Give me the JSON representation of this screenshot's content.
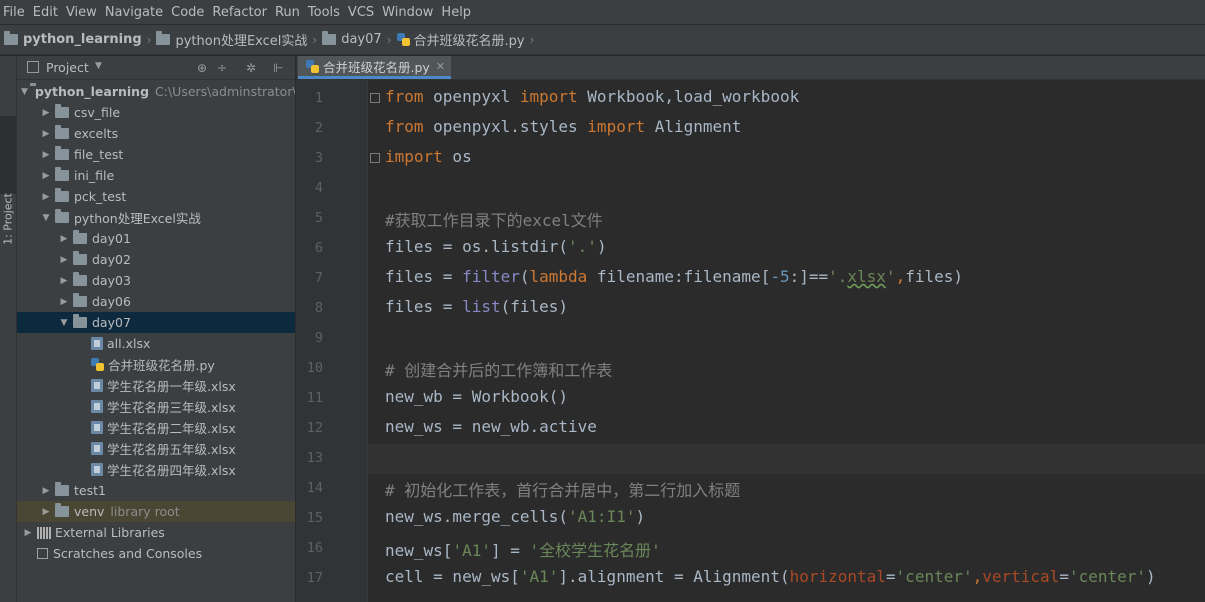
{
  "menu": [
    "File",
    "Edit",
    "View",
    "Navigate",
    "Code",
    "Refactor",
    "Run",
    "Tools",
    "VCS",
    "Window",
    "Help"
  ],
  "breadcrumbs": [
    {
      "label": "python_learning",
      "icon": "folder",
      "bold": true
    },
    {
      "label": "python处理Excel实战",
      "icon": "folder",
      "bold": false
    },
    {
      "label": "day07",
      "icon": "folder",
      "bold": false
    },
    {
      "label": "合并班级花名册.py",
      "icon": "python-file",
      "bold": false
    }
  ],
  "sidebar_strip_label": "1: Project",
  "project_panel": {
    "title": "Project",
    "tree": [
      {
        "label": "python_learning",
        "extra": "C:\\Users\\adminstrator\\",
        "depth": 0,
        "arrow": "down",
        "icon": "folder",
        "bold": true
      },
      {
        "label": "csv_file",
        "depth": 1,
        "arrow": "right",
        "icon": "folder"
      },
      {
        "label": "excelts",
        "depth": 1,
        "arrow": "right",
        "icon": "folder"
      },
      {
        "label": "file_test",
        "depth": 1,
        "arrow": "right",
        "icon": "folder"
      },
      {
        "label": "ini_file",
        "depth": 1,
        "arrow": "right",
        "icon": "folder"
      },
      {
        "label": "pck_test",
        "depth": 1,
        "arrow": "right",
        "icon": "folder"
      },
      {
        "label": "python处理Excel实战",
        "depth": 1,
        "arrow": "down",
        "icon": "folder"
      },
      {
        "label": "day01",
        "depth": 2,
        "arrow": "right",
        "icon": "folder"
      },
      {
        "label": "day02",
        "depth": 2,
        "arrow": "right",
        "icon": "folder"
      },
      {
        "label": "day03",
        "depth": 2,
        "arrow": "right",
        "icon": "folder"
      },
      {
        "label": "day06",
        "depth": 2,
        "arrow": "right",
        "icon": "folder"
      },
      {
        "label": "day07",
        "depth": 2,
        "arrow": "down",
        "icon": "folder",
        "selected": true
      },
      {
        "label": "all.xlsx",
        "depth": 3,
        "arrow": "",
        "icon": "xlsx"
      },
      {
        "label": "合并班级花名册.py",
        "depth": 3,
        "arrow": "",
        "icon": "python"
      },
      {
        "label": "学生花名册一年级.xlsx",
        "depth": 3,
        "arrow": "",
        "icon": "xlsx"
      },
      {
        "label": "学生花名册三年级.xlsx",
        "depth": 3,
        "arrow": "",
        "icon": "xlsx"
      },
      {
        "label": "学生花名册二年级.xlsx",
        "depth": 3,
        "arrow": "",
        "icon": "xlsx"
      },
      {
        "label": "学生花名册五年级.xlsx",
        "depth": 3,
        "arrow": "",
        "icon": "xlsx"
      },
      {
        "label": "学生花名册四年级.xlsx",
        "depth": 3,
        "arrow": "",
        "icon": "xlsx"
      },
      {
        "label": "test1",
        "depth": 1,
        "arrow": "right",
        "icon": "folder"
      },
      {
        "label": "venv",
        "extra": "library root",
        "depth": 1,
        "arrow": "right",
        "icon": "folder",
        "venv": true
      },
      {
        "label": "External Libraries",
        "depth": 0,
        "arrow": "right",
        "icon": "library"
      },
      {
        "label": "Scratches and Consoles",
        "depth": 0,
        "arrow": "",
        "icon": "scratch"
      }
    ]
  },
  "editor": {
    "tab_label": "合并班级花名册.py",
    "current_line": 13,
    "lines": [
      [
        [
          "kw",
          "from"
        ],
        [
          "p",
          " openpyxl "
        ],
        [
          "kw",
          "import"
        ],
        [
          "p",
          " Workbook,load_workbook"
        ]
      ],
      [
        [
          "kw",
          "from"
        ],
        [
          "p",
          " openpyxl.styles "
        ],
        [
          "kw",
          "import"
        ],
        [
          "p",
          " Alignment"
        ]
      ],
      [
        [
          "kw",
          "import"
        ],
        [
          "p",
          " os"
        ]
      ],
      [],
      [
        [
          "cmt",
          "#获取工作目录下的excel文件"
        ]
      ],
      [
        [
          "p",
          "files = os.listdir("
        ],
        [
          "str",
          "'.'"
        ],
        [
          "p",
          ")"
        ]
      ],
      [
        [
          "p",
          "files = "
        ],
        [
          "bi",
          "filter"
        ],
        [
          "p",
          "("
        ],
        [
          "kw",
          "lambda"
        ],
        [
          "p",
          " filename:filename["
        ],
        [
          "num",
          "-5"
        ],
        [
          "p",
          ":]=="
        ],
        [
          "str",
          "'."
        ],
        [
          "sq",
          "xlsx"
        ],
        [
          "str",
          "'"
        ],
        [
          "kw",
          ","
        ],
        [
          "p",
          "files)"
        ]
      ],
      [
        [
          "p",
          "files = "
        ],
        [
          "bi",
          "list"
        ],
        [
          "p",
          "(files)"
        ]
      ],
      [],
      [
        [
          "cmt",
          "# 创建合并后的工作簿和工作表"
        ]
      ],
      [
        [
          "p",
          "new_wb = Workbook()"
        ]
      ],
      [
        [
          "p",
          "new_ws = new_wb.active"
        ]
      ],
      [],
      [
        [
          "cmt",
          "# 初始化工作表，首行合并居中，第二行加入标题"
        ]
      ],
      [
        [
          "p",
          "new_ws.merge_cells("
        ],
        [
          "str",
          "'A1:I1'"
        ],
        [
          "p",
          ")"
        ]
      ],
      [
        [
          "p",
          "new_ws["
        ],
        [
          "str",
          "'A1'"
        ],
        [
          "p",
          "] = "
        ],
        [
          "str",
          "'全校学生花名册'"
        ]
      ],
      [
        [
          "p",
          "cell = new_ws["
        ],
        [
          "str",
          "'A1'"
        ],
        [
          "p",
          "].alignment = Alignment("
        ],
        [
          "param",
          "horizontal"
        ],
        [
          "p",
          "="
        ],
        [
          "str",
          "'center'"
        ],
        [
          "kw",
          ","
        ],
        [
          "param",
          "vertical"
        ],
        [
          "p",
          "="
        ],
        [
          "str",
          "'center'"
        ],
        [
          "p",
          ")"
        ]
      ]
    ]
  }
}
